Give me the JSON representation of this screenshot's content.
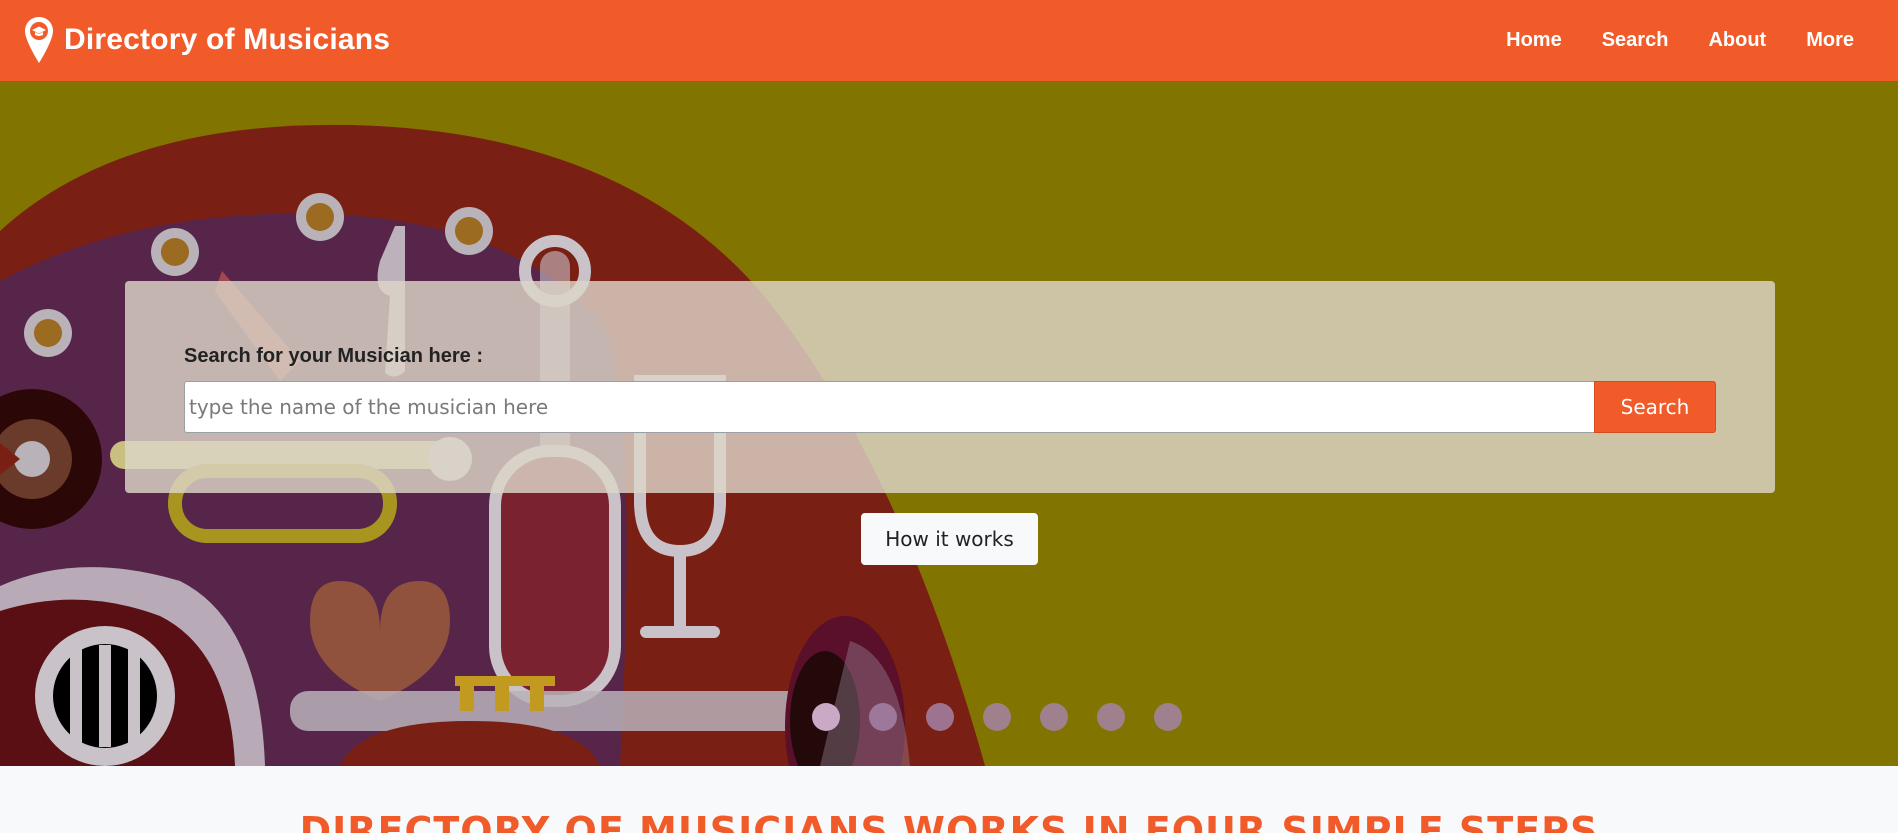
{
  "brand": {
    "title": "Directory of Musicians",
    "icon": "map-pin-graduation-cap-icon"
  },
  "nav": {
    "items": [
      {
        "label": "Home"
      },
      {
        "label": "Search"
      },
      {
        "label": "About"
      },
      {
        "label": "More"
      }
    ]
  },
  "hero": {
    "search_label": "Search for your Musician here :",
    "search_placeholder": "type the name of the musician here",
    "search_value": "",
    "search_button": "Search",
    "how_button": "How it works",
    "carousel": {
      "slides": 7,
      "active_index": 0
    }
  },
  "steps": {
    "title": "DIRECTORY OF MUSICIANS WORKS IN FOUR SIMPLE STEPS"
  },
  "colors": {
    "brand_orange": "#f15a29",
    "hero_olive": "#827400",
    "panel_beige": "#ddd6c8",
    "light_bg": "#f8f9fa"
  }
}
